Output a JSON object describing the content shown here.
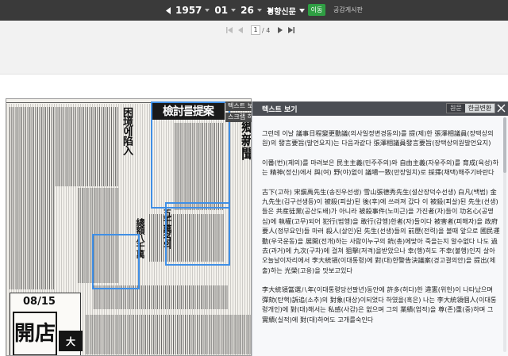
{
  "nav": {
    "year": "1957",
    "month": "01",
    "day": "26",
    "newspaper": "경향신문",
    "go_label": "이동",
    "notice_link": "공감게시판"
  },
  "pager": {
    "current": "1",
    "total": "/ 4"
  },
  "newspaper": {
    "banner": "檢討를提案",
    "logo": "郷新聞",
    "headline_1": "困境에陷入",
    "headline_2": "五千萬名의",
    "headline_3": "總額八千萬",
    "ad_date": "08/15",
    "ad_big": "開店",
    "ad_bar": "大"
  },
  "side_labels": {
    "label_1": "텍스트 보",
    "label_2": "스크랩 하"
  },
  "text_panel": {
    "title": "텍스트 보기",
    "tab_original": "원문",
    "tab_converted": "한글변환",
    "paragraphs": [
      "그런데 이날 議事日程變更動議(의사일정변경동의)를 提(제)한 張澤相議員(장택상의원)의 發言要旨(발언요지)는 다음과같다 張澤相議員發言要旨(장택상의원발언요지)",
      "이番(번)(제의)를 마려보은 民主主義(민주주의)와 自由主義(자유주의)를 育成(육성)하는 精神(정신)에서 與(여) 野(야)없이 議場一致(만장일치)로 採擇(채택)해주기바란다",
      "古下(고하) 宋鎭禹先生(송진우선생) 雪山張德秀先生(설산장덕수선생) 白凡(백범) 金九先生(김구선생등)이 被殺(피살)된 後(후)에 쓰러져 갔다 이 被殺(피살)된 先生(선생)들은 共産徒黨(공산도배)가 아니라 被殺事件(노미근)을 가진者(자)들이 功名心(공명심)에 執權(고무)되어 犯行(범행)을 敢行(감행)한者(자)들이다 被害者(피해자)을 政府要人(정부요인)들 마러 殺人(살인)된 先生(선생)들의 前歷(전력)을 볼때 앞으로 國民運動(우국운동)을 展開(전개)하는 사람이누구의 銃(총)에맞아 죽을는지 알수없다 나도 過去(과거)에 九次(구차)에 걸쳐 狙擊(저격)을받았으나 幸(행)히도 不幸(불행)인지 살아오늘날이자리에서 李大統領(이대통령)에 對(대)한警告決議案(경고결의안)을 提出(제출)하는 光榮(고용)을 맛보고있다",
      "李大統領當選八年(이대통령당선팔년)동안에 許多(허다)한 違憲(위헌)이 나타났으며 彈劾(탄핵)訴追(소추)의 對象(대상)이되었다 하였을(혹은) 나는 李大統領個人(이대통령개인)에 對(대)해서는 私感(사감)은 없으며 그의 業績(업적)을 尊(존)重(중)하며 그 實績(실적)에 對(대)하여도 고개를숙인다"
    ]
  }
}
